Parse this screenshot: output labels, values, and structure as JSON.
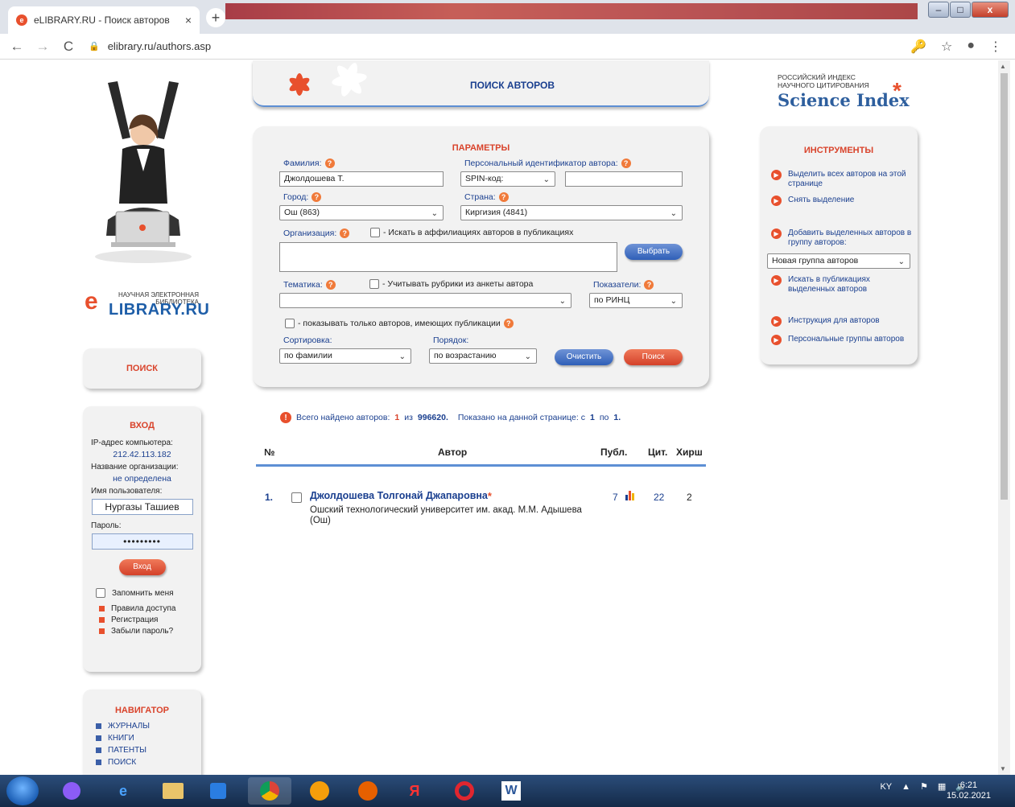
{
  "browser": {
    "tab_title": "eLIBRARY.RU - Поиск авторов",
    "tab_close": "×",
    "new_tab": "+",
    "url": "elibrary.ru/authors.asp",
    "back": "←",
    "forward": "→",
    "reload": "C",
    "lock": "🔒",
    "key_icon": "🔑",
    "star_icon": "☆",
    "account_icon": "●",
    "menu_icon": "⋮",
    "win_min": "–",
    "win_max": "□",
    "win_close": "x"
  },
  "left": {
    "logo_small": "НАУЧНАЯ ЭЛЕКТРОННАЯ БИБЛИОТЕКА",
    "logo_main": "LIBRARY.RU",
    "logo_e": "e",
    "search_title": "ПОИСК",
    "login": {
      "title": "ВХОД",
      "ip_label": "IP-адрес компьютера:",
      "ip_value": "212.42.113.182",
      "org_label": "Название организации:",
      "org_value": "не определена",
      "user_label": "Имя пользователя:",
      "user_value": "Нургазы Ташиев",
      "password_label": "Пароль:",
      "password_value": "•••••••••",
      "login_button": "Вход",
      "remember_label": "Запомнить меня",
      "links": [
        "Правила доступа",
        "Регистрация",
        "Забыли пароль?"
      ]
    },
    "navigator": {
      "title": "НАВИГАТОР",
      "items": [
        "ЖУРНАЛЫ",
        "КНИГИ",
        "ПАТЕНТЫ",
        "ПОИСК"
      ]
    }
  },
  "header": {
    "title": "ПОИСК АВТОРОВ"
  },
  "params": {
    "title": "ПАРАМЕТРЫ",
    "help": "?",
    "surname_label": "Фамилия:",
    "surname_value": "Джолдошева Т.",
    "personal_id_label": "Персональный идентификатор автора:",
    "id_type_value": "SPIN-код:",
    "id_value": "",
    "city_label": "Город:",
    "city_value": "Ош  (863)",
    "country_label": "Страна:",
    "country_value": "Киргизия  (4841)",
    "org_label": "Организация:",
    "affil_checkbox_label": "- Искать в аффилиациях авторов в публикациях",
    "choose_button": "Выбрать",
    "topic_label": "Тематика:",
    "rubric_checkbox_label": "- Учитывать рубрики из анкеты автора",
    "topic_value": "",
    "indicators_label": "Показатели:",
    "indicators_value": "по РИНЦ",
    "only_with_pubs_label": "- показывать только авторов, имеющих публикации",
    "sort_label": "Сортировка:",
    "sort_value": "по фамилии",
    "order_label": "Порядок:",
    "order_value": "по возрастанию",
    "clear_button": "Очистить",
    "search_button": "Поиск",
    "chevron": "⌄"
  },
  "results": {
    "summary_prefix": "Всего найдено авторов:",
    "found": "1",
    "of_word": "из",
    "total": "996620.",
    "shown_prefix": "Показано на данной странице: с",
    "from": "1",
    "to_word": "по",
    "to": "1.",
    "columns": {
      "num": "№",
      "author": "Автор",
      "pubs": "Публ.",
      "cites": "Цит.",
      "hirsch": "Хирш"
    },
    "rows": [
      {
        "num": "1.",
        "name": "Джолдошева  Толгонай  Джапаровна",
        "star": "*",
        "org": "Ошский технологический университет им. акад. М.М. Адышева (Ош)",
        "pubs": "7",
        "cites": "22",
        "hirsch": "2"
      }
    ]
  },
  "right": {
    "si_small": "РОССИЙСКИЙ ИНДЕКС НАУЧНОГО ЦИТИРОВАНИЯ",
    "si_big": "Science Index",
    "si_star": "*",
    "tools_title": "ИНСТРУМЕНТЫ",
    "tools": [
      "Выделить всех авторов на этой странице",
      "Снять выделение",
      "Добавить выделенных авторов в группу авторов:",
      "Искать в публикациях выделенных авторов",
      "Инструкция для авторов",
      "Персональные группы авторов"
    ],
    "group_select": "Новая группа авторов",
    "tool_arrow": "▶"
  },
  "taskbar": {
    "lang": "KY",
    "time": "6:21",
    "date": "15.02.2021"
  },
  "colors": {
    "accent_red": "#e8502d",
    "accent_blue": "#1a3f8f",
    "panel_bg": "#f2f2f2"
  }
}
